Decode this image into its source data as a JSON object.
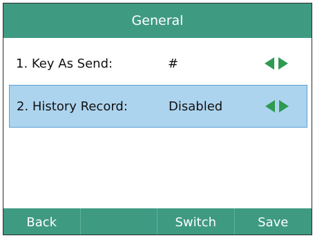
{
  "title": "General",
  "rows": [
    {
      "label": "1. Key As Send:",
      "value": "#"
    },
    {
      "label": "2. History Record:",
      "value": "Disabled"
    }
  ],
  "softkeys": [
    "Back",
    "",
    "Switch",
    "Save"
  ],
  "colors": {
    "accent": "#3f9a82",
    "selected_row": "#add4ee",
    "arrow": "#2f9a52"
  },
  "icons": {
    "left": "arrow-left-icon",
    "right": "arrow-right-icon"
  }
}
